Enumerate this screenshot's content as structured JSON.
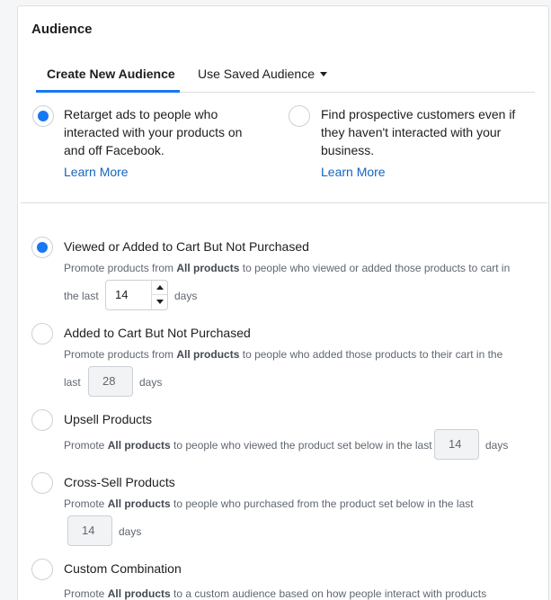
{
  "section_title": "Audience",
  "tabs": {
    "create": "Create New Audience",
    "saved": "Use Saved Audience"
  },
  "audience_type": {
    "retarget": {
      "lines": [
        "Retarget ads to people who",
        "interacted with your products on",
        "and off Facebook."
      ],
      "link": "Learn More",
      "selected": true
    },
    "prospect": {
      "lines": [
        "Find prospective customers even if",
        "they haven't interacted with your",
        "business."
      ],
      "link": "Learn More",
      "selected": false
    }
  },
  "options": {
    "viewed": {
      "title": "Viewed or Added to Cart But Not Purchased",
      "desc_pre": "Promote products from ",
      "desc_bold": "All products",
      "desc_post": " to people who viewed or added those products to cart in",
      "line2": "the last",
      "value": "14",
      "unit": "days",
      "selected": true
    },
    "added": {
      "title": "Added to Cart But Not Purchased",
      "desc_pre": "Promote products from ",
      "desc_bold": "All products",
      "desc_post": " to people who added those products to their cart in the",
      "line2": "last",
      "value": "28",
      "unit": "days",
      "selected": false
    },
    "upsell": {
      "title": "Upsell Products",
      "desc_pre": "Promote ",
      "desc_bold": "All products",
      "desc_post": " to people who viewed the product set below in the last",
      "value": "14",
      "unit": "days",
      "selected": false
    },
    "crosssell": {
      "title": "Cross-Sell Products",
      "desc_pre": "Promote ",
      "desc_bold": "All products",
      "desc_post": " to people who purchased from the product set below in the last",
      "value": "14",
      "unit": "days",
      "selected": false
    },
    "custom": {
      "title": "Custom Combination",
      "desc_pre": "Promote ",
      "desc_bold": "All products",
      "desc_post": " to a custom audience based on how people interact with products",
      "selected": false
    }
  },
  "colors": {
    "accent": "#1877f2",
    "link": "#1565c0"
  }
}
